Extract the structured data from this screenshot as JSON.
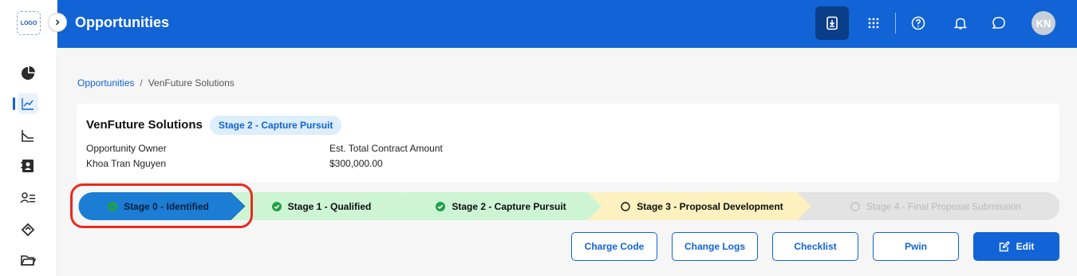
{
  "sidebar": {
    "logo_text": "LOGO",
    "items": [
      {
        "name": "dashboard",
        "icon": "pie-chart-icon"
      },
      {
        "name": "opportunities",
        "icon": "trend-chart-icon",
        "active": true
      },
      {
        "name": "reports",
        "icon": "graph-icon"
      },
      {
        "name": "contacts",
        "icon": "contact-card-icon"
      },
      {
        "name": "users",
        "icon": "user-list-icon"
      },
      {
        "name": "deals",
        "icon": "handshake-icon"
      },
      {
        "name": "files",
        "icon": "folder-icon"
      }
    ]
  },
  "header": {
    "title": "Opportunities",
    "avatar_initials": "KN"
  },
  "breadcrumb": {
    "root": "Opportunities",
    "separator": "/",
    "current": "VenFuture Solutions"
  },
  "opportunity": {
    "name": "VenFuture Solutions",
    "stage_badge": "Stage 2 - Capture Pursuit",
    "owner_label": "Opportunity Owner",
    "owner_value": "Khoa Tran Nguyen",
    "amount_label": "Est. Total Contract Amount",
    "amount_value": "$300,000.00"
  },
  "stages": [
    {
      "label": "Stage 0 - Identified",
      "status": "current"
    },
    {
      "label": "Stage 1 - Qualified",
      "status": "done"
    },
    {
      "label": "Stage 2 - Capture Pursuit",
      "status": "done"
    },
    {
      "label": "Stage 3 - Proposal Development",
      "status": "pending"
    },
    {
      "label": "Stage 4 - Final Proposal Submission",
      "status": "disabled"
    }
  ],
  "actions": {
    "charge_code": "Charge Code",
    "change_logs": "Change Logs",
    "checklist": "Checklist",
    "pwin": "Pwin",
    "edit": "Edit"
  },
  "colors": {
    "primary": "#1163d6",
    "header_dark_button": "#0a3d87",
    "stage_current": "#1b7dd4",
    "stage_done": "#cdf5d3",
    "stage_pending": "#fdf1bf",
    "stage_disabled": "#e3e3e3",
    "highlight": "#ea2a1d"
  }
}
